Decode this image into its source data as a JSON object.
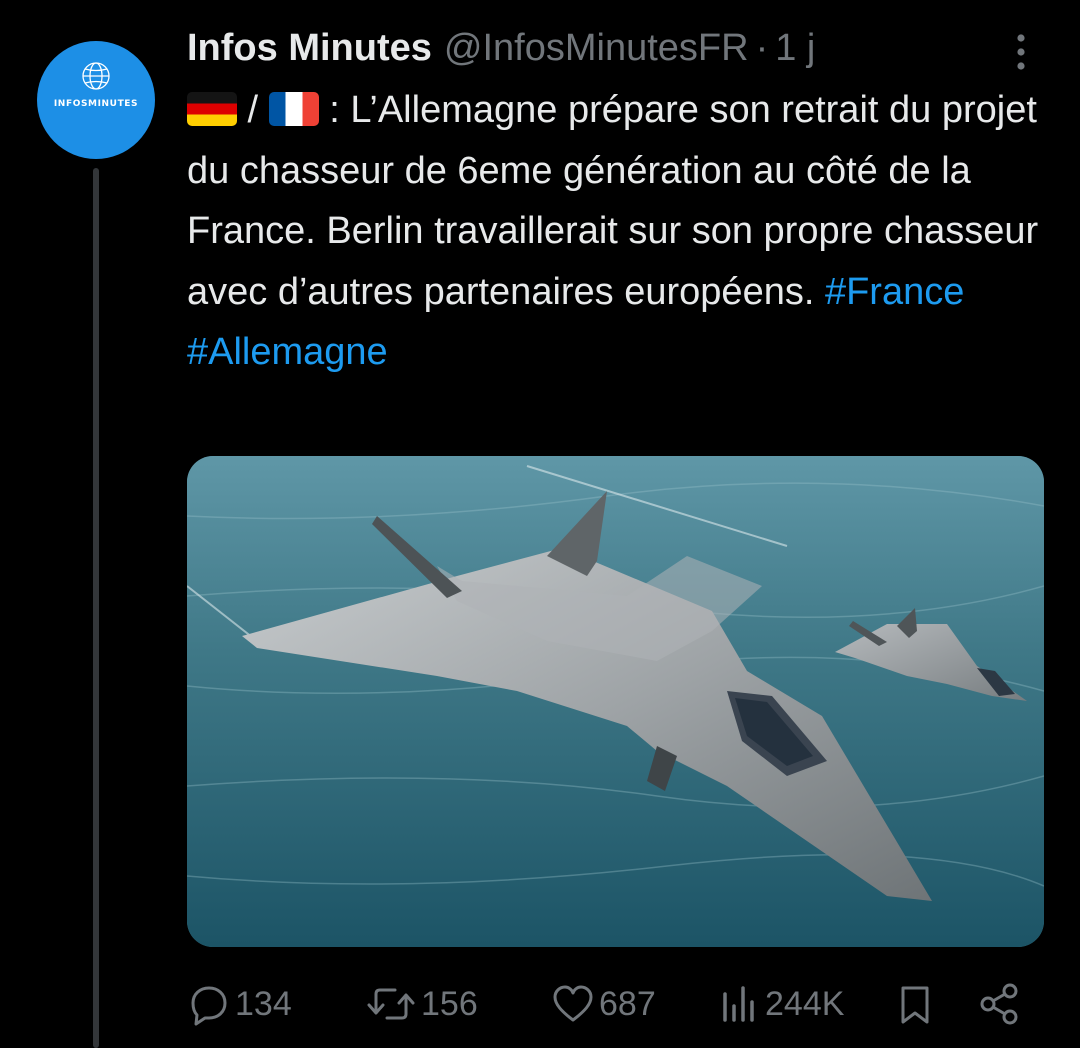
{
  "author": {
    "name": "Infos Minutes",
    "handle": "@InfosMinutesFR",
    "separator": "·",
    "time": "1 j",
    "avatar_text": "INFOSMINUTES"
  },
  "tweet": {
    "flag_de": "german-flag",
    "slash": " / ",
    "flag_fr": "french-flag",
    "text": " : L’Allemagne prépare son retrait du projet du chasseur de 6eme génération au côté de la France. Berlin travaillerait sur son propre chasseur avec d’autres partenaires européens. ",
    "hashtag_1": "#France",
    "hashtag_2": "#Allemagne"
  },
  "actions": {
    "replies": "134",
    "reposts": "156",
    "likes": "687",
    "views": "244K"
  },
  "colors": {
    "background": "#000000",
    "text": "#e7e9ea",
    "muted": "#71767b",
    "link": "#1d9bf0",
    "avatar": "#1d8fe6",
    "thread_line": "#333639"
  }
}
